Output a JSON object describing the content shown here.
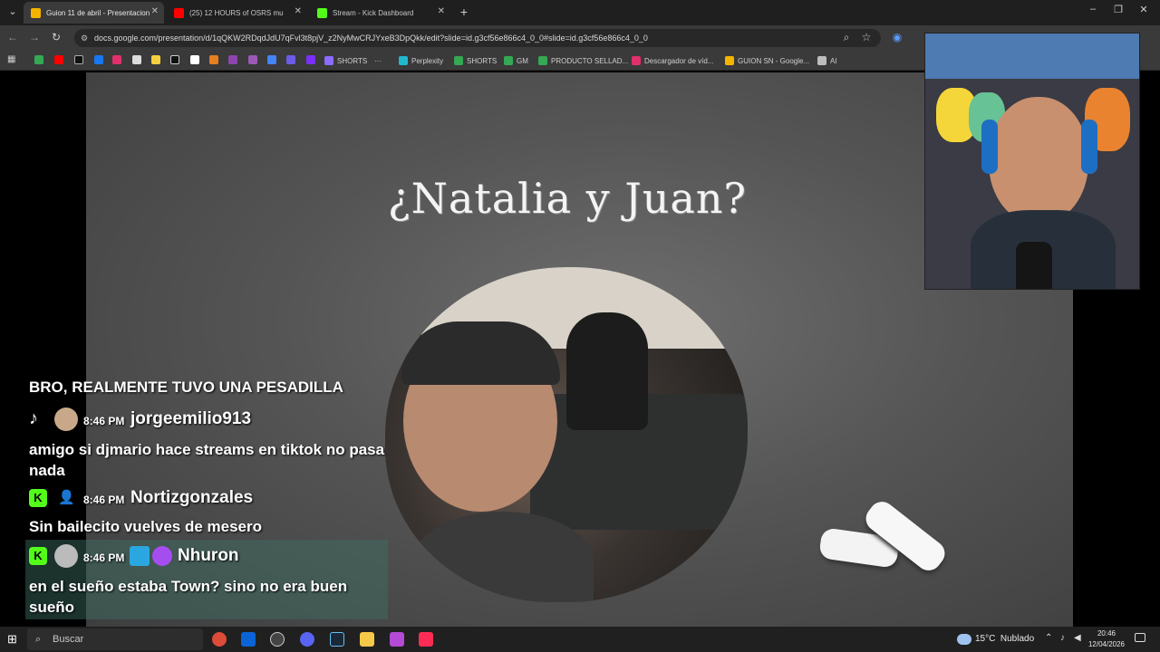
{
  "browser": {
    "tabs": [
      {
        "label": "Guion 11 de abril - Presentacion",
        "active": true,
        "favicon_color": "#f4b400"
      },
      {
        "label": "(25) 12 HOURS of OSRS mu",
        "active": false,
        "favicon_color": "#ff0000"
      },
      {
        "label": "Stream - Kick Dashboard",
        "active": false,
        "favicon_color": "#53fc18"
      }
    ],
    "new_tab": "+",
    "window_controls": {
      "minimize": "–",
      "restore": "❐",
      "close": "✕"
    },
    "url": "docs.google.com/presentation/d/1qQKW2RDqdJdU7qFvl3t8pjV_z2NyMwCRJYxeB3DpQkk/edit?slide=id.g3cf56e866c4_0_0#slide=id.g3cf56e866c4_0_0",
    "bookmarks": [
      {
        "label": "SHORTS",
        "color": "#8a6cff"
      },
      {
        "label": "Perplexity",
        "color": "#20b8cd"
      },
      {
        "label": "SHORTS",
        "color": "#34a853"
      },
      {
        "label": "GM",
        "color": "#34a853"
      },
      {
        "label": "PRODUCTO SELLAD...",
        "color": "#34a853"
      },
      {
        "label": "Descargador de víd...",
        "color": "#e1306c"
      },
      {
        "label": "GUION SN - Google...",
        "color": "#f4b400"
      },
      {
        "label": "AI",
        "color": "#bdbdbd"
      }
    ]
  },
  "slide": {
    "title": "¿Natalia y Juan?"
  },
  "chat": {
    "partial_top": "BRO, REALMENTE TUVO UNA PESADILLA",
    "messages": [
      {
        "platform": "tiktok",
        "time": "8:46 PM",
        "user": "jorgeemilio913",
        "text": "amigo si djmario hace streams en tiktok no pasa nada"
      },
      {
        "platform": "kick",
        "time": "8:46 PM",
        "user": "Nortizgonzales",
        "text": "Sin bailecito vuelves de mesero"
      },
      {
        "platform": "kick",
        "time": "8:46 PM",
        "user": "Nhuron",
        "text": "en el sueño estaba Town? sino no era buen sueño"
      }
    ]
  },
  "taskbar": {
    "search_placeholder": "Buscar",
    "weather": "15°C  Nublado",
    "time": "20:46",
    "date": "12/04/2026"
  }
}
